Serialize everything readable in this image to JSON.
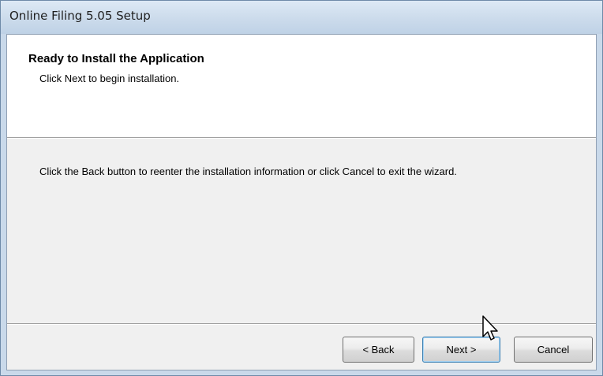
{
  "window": {
    "title": "Online Filing 5.05 Setup"
  },
  "header": {
    "title": "Ready to Install the Application",
    "subtitle": "Click Next to begin installation."
  },
  "body": {
    "message": "Click the Back button to reenter the installation information or click Cancel to exit the wizard."
  },
  "buttons": {
    "back": "< Back",
    "next": "Next >",
    "cancel": "Cancel"
  },
  "icons": {
    "cursor": "arrow-cursor-icon"
  }
}
